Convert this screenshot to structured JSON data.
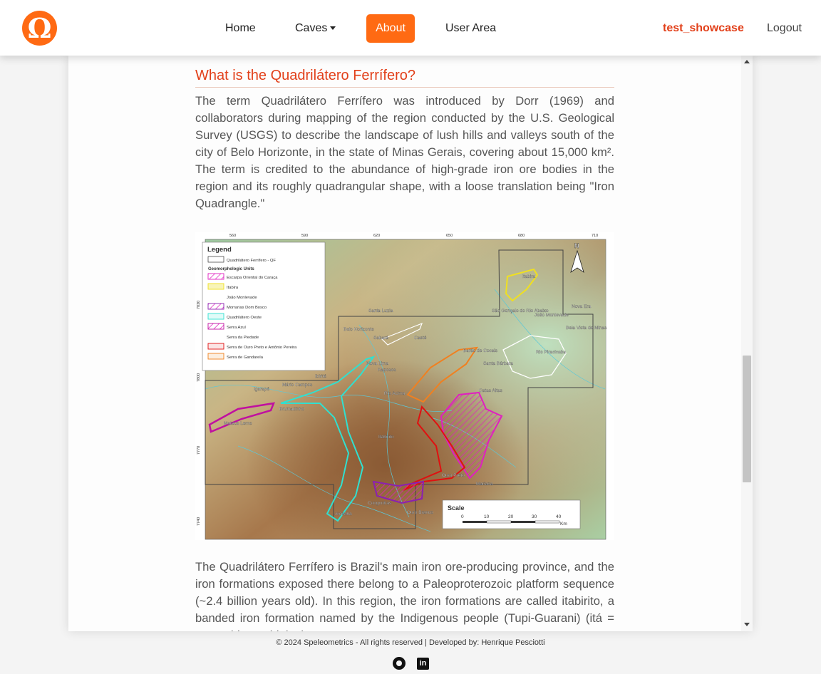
{
  "nav": {
    "logo_glyph": "Ω",
    "items": [
      {
        "label": "Home"
      },
      {
        "label": "Caves"
      },
      {
        "label": "About",
        "active": true
      },
      {
        "label": "User Area"
      }
    ],
    "username": "test_showcase",
    "logout": "Logout"
  },
  "content": {
    "heading": "What is the Quadrilátero Ferrífero?",
    "paragraph1": "The term Quadrilátero Ferrífero was introduced by Dorr (1969) and collaborators during mapping of the region conducted by the U.S. Geological Survey (USGS) to describe the landscape of lush hills and valleys south of the city of Belo Horizonte, in the state of Minas Gerais, covering about 15,000 km². The term is credited to the abundance of high-grade iron ore bodies in the region and its roughly quadrangular shape, with a loose translation being \"Iron Quadrangle.\"",
    "paragraph2": "The Quadrilátero Ferrífero is Brazil's main iron ore-producing province, and the iron formations exposed there belong to a Paleoproterozoic platform sequence (~2.4 billion years old). In this region, the iron formations are called itabirito, a banded iron formation named by the Indigenous people (Tupi-Guarani) (itá = stone, bira = shining)"
  },
  "map": {
    "top_ticks": [
      "560",
      "590",
      "620",
      "650",
      "680",
      "710"
    ],
    "left_ticks": [
      "7830",
      "7800",
      "7770",
      "7740"
    ],
    "legend": {
      "title": "Legend",
      "boundary_label": "Quadrilátero Ferrífero - QF",
      "units_title": "Geomorphologic Units",
      "units": [
        {
          "label": "Escarpa Oriental do Caraça",
          "color": "#e020c0"
        },
        {
          "label": "Itabira",
          "color": "#f0e020"
        },
        {
          "label": "João Monlevade",
          "color": "#ffffff"
        },
        {
          "label": "Morrarias Dom Bosco",
          "color": "#8a20b0"
        },
        {
          "label": "Quadrilátero Oeste",
          "color": "#30e0d0"
        },
        {
          "label": "Serra Azul",
          "color": "#c010a0"
        },
        {
          "label": "Serra da Piedade",
          "color": "#ffffff"
        },
        {
          "label": "Serra de Ouro Preto e Antônio Pereira",
          "color": "#e01010"
        },
        {
          "label": "Serra de Gandarela",
          "color": "#f08020"
        }
      ]
    },
    "places": [
      "Itabira",
      "Santa Luzia",
      "Nova Era",
      "São Gonçalo do Rio Abaixo",
      "João Monlevade",
      "Bela Vista de Minas",
      "Belo Horizonte",
      "Sabará",
      "Caeté",
      "Rio Piracicaba",
      "Barão de Cocais",
      "Santa Bárbara",
      "Nova Lima",
      "Raposos",
      "Ibirité",
      "Igarapé",
      "Mário Campos",
      "Rio Acima",
      "Catas Altas",
      "Brumadinho",
      "Mateus Leme",
      "Itabirito",
      "Ouro Preto",
      "Mariana",
      "Congonhas",
      "Ouro Branco",
      "Jeceaba"
    ],
    "north_label": "N",
    "scale": {
      "title": "Scale",
      "ticks": [
        "0",
        "10",
        "20",
        "30",
        "40"
      ],
      "unit": "Km"
    }
  },
  "footer": {
    "text": "© 2024 Speleometrics - All rights reserved | Developed by: Henrique Pesciotti",
    "github_icon": "github-icon",
    "linkedin_icon": "linkedin-icon",
    "linkedin_glyph": "in"
  }
}
